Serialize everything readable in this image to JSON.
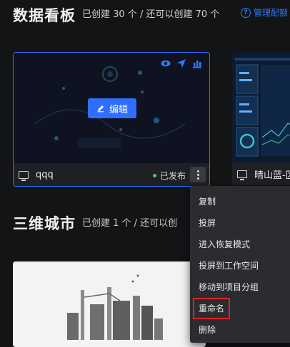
{
  "sections": {
    "dashboard": {
      "title": "数据看板",
      "meta": "已创建 30 个 / 还可以创建 70 个",
      "help_label": "管理配额"
    },
    "city": {
      "title": "三维城市",
      "meta": "已创建 1 个 / 还可以创"
    }
  },
  "cards": {
    "qqq": {
      "name": "qqq",
      "status": "已发布",
      "edit_label": "编辑",
      "icons": [
        "eye-icon",
        "send-icon",
        "bar-chart-icon"
      ]
    },
    "second": {
      "name": "晴山蓝-区"
    }
  },
  "context_menu": {
    "items": [
      "复制",
      "投屏",
      "进入恢复模式",
      "投屏到工作空间",
      "移动到项目分组",
      "重命名",
      "删除"
    ],
    "highlighted": "重命名"
  },
  "colors": {
    "accent": "#2f6fff",
    "highlight": "#e32020",
    "published": "#3fd06b"
  }
}
